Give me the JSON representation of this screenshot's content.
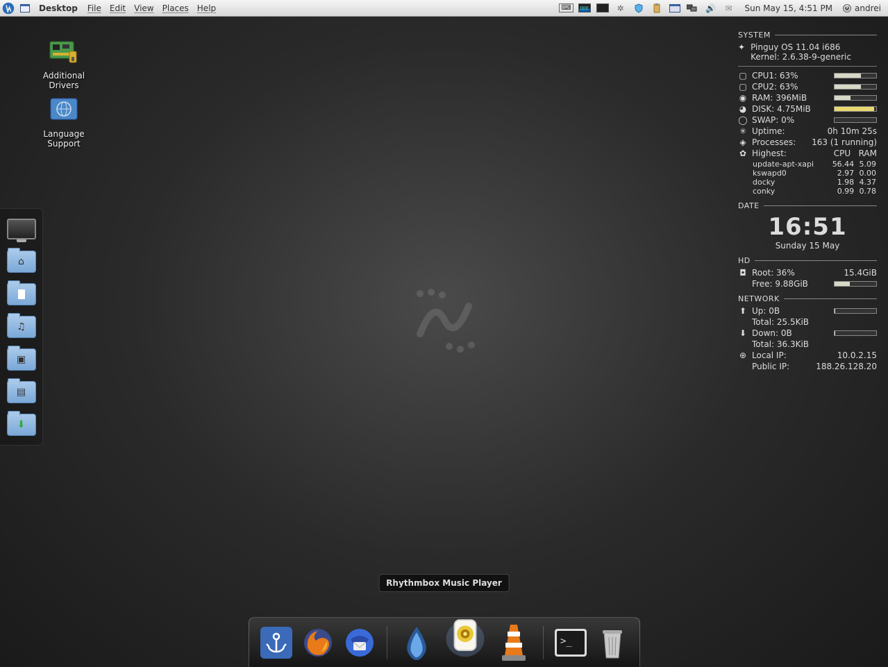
{
  "panel": {
    "app_title": "Desktop",
    "menus": [
      "File",
      "Edit",
      "View",
      "Places",
      "Help"
    ],
    "clock": "Sun May 15,  4:51 PM",
    "user": "andrei"
  },
  "desktop_icons": [
    {
      "label": "Additional Drivers"
    },
    {
      "label": "Language Support"
    }
  ],
  "left_dock": [
    "desktop",
    "home",
    "documents",
    "music",
    "pictures",
    "videos",
    "downloads"
  ],
  "conky": {
    "system_header": "SYSTEM",
    "os": "Pinguy OS 11.04 i686",
    "kernel": "Kernel: 2.6.38-9-generic",
    "cpu1": {
      "label": "CPU1: 63%",
      "pct": 63
    },
    "cpu2": {
      "label": "CPU2: 63%",
      "pct": 63
    },
    "ram": {
      "label": "RAM: 396MiB",
      "pct": 39
    },
    "disk": {
      "label": "DISK: 4.75MiB",
      "pct": 95
    },
    "swap": {
      "label": "SWAP: 0%",
      "pct": 0
    },
    "uptime": {
      "label": "Uptime:",
      "val": "0h 10m 25s"
    },
    "processes": {
      "label": "Processes:",
      "val": "163 (1 running)"
    },
    "highest": {
      "label": "Highest:",
      "cpu": "CPU",
      "ram": "RAM"
    },
    "procs": [
      {
        "name": "update-apt-xapi",
        "cpu": "56.44",
        "ram": "5.09"
      },
      {
        "name": "kswapd0",
        "cpu": "2.97",
        "ram": "0.00"
      },
      {
        "name": "docky",
        "cpu": "1.98",
        "ram": "4.37"
      },
      {
        "name": "conky",
        "cpu": "0.99",
        "ram": "0.78"
      }
    ],
    "date_header": "DATE",
    "time": "16:51",
    "date": "Sunday 15 May",
    "hd_header": "HD",
    "root": {
      "label": "Root: 36%",
      "val": "15.4GiB",
      "pct": 36
    },
    "free": "Free: 9.88GiB",
    "net_header": "NETWORK",
    "up": {
      "label": "Up: 0B",
      "total": "Total: 25.5KiB"
    },
    "down": {
      "label": "Down: 0B",
      "total": "Total: 36.3KiB"
    },
    "local_ip": {
      "label": "Local IP:",
      "val": "10.0.2.15"
    },
    "public_ip": {
      "label": "Public IP:",
      "val": "188.26.128.20"
    }
  },
  "bottom_dock": {
    "tooltip": "Rhythmbox Music Player",
    "apps": [
      "anchor",
      "firefox",
      "thunderbird",
      "sep",
      "deluge",
      "rhythmbox",
      "vlc",
      "sep",
      "terminal",
      "trash"
    ]
  }
}
